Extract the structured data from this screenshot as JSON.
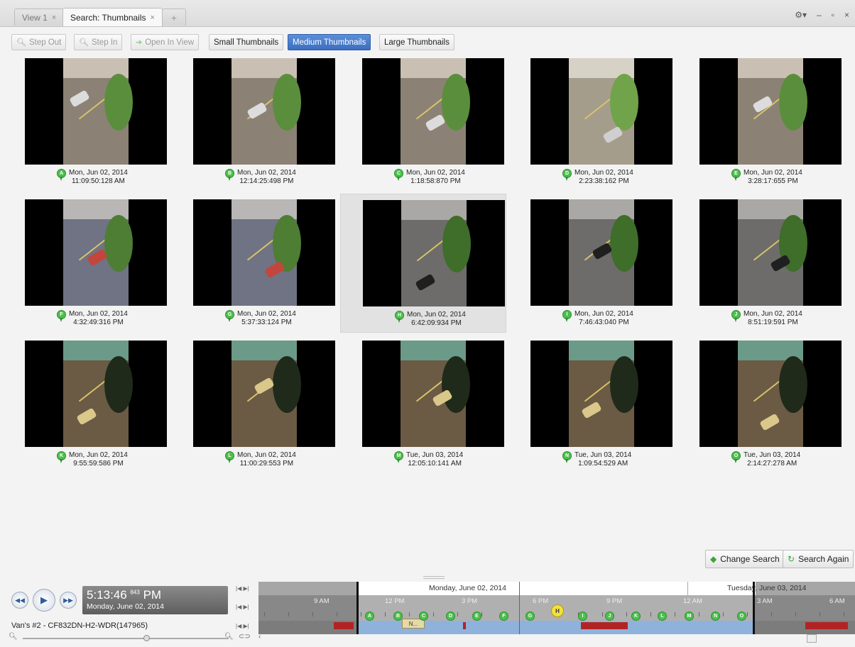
{
  "tabs": [
    {
      "label": "View 1",
      "close": "×"
    },
    {
      "label": "Search: Thumbnails",
      "close": "×"
    },
    {
      "label": "+"
    }
  ],
  "window_controls": {
    "settings": "⚙▾",
    "minimize": "–",
    "maximize": "▫",
    "close": "×"
  },
  "toolbar": {
    "step_out": "Step Out",
    "step_in": "Step In",
    "open_in_view": "Open In View",
    "small": "Small Thumbnails",
    "medium": "Medium Thumbnails",
    "large": "Large Thumbnails",
    "selected": "Medium Thumbnails"
  },
  "thumbnails": [
    {
      "pin": "A",
      "date": "Mon, Jun 02, 2014",
      "time": "11:09:50:128 AM",
      "tone": "day"
    },
    {
      "pin": "B",
      "date": "Mon, Jun 02, 2014",
      "time": "12:14:25:498 PM",
      "tone": "day"
    },
    {
      "pin": "C",
      "date": "Mon, Jun 02, 2014",
      "time": "1:18:58:870 PM",
      "tone": "day"
    },
    {
      "pin": "D",
      "date": "Mon, Jun 02, 2014",
      "time": "2:23:38:162 PM",
      "tone": "bright"
    },
    {
      "pin": "E",
      "date": "Mon, Jun 02, 2014",
      "time": "3:28:17:655 PM",
      "tone": "day"
    },
    {
      "pin": "F",
      "date": "Mon, Jun 02, 2014",
      "time": "4:32:49:316 PM",
      "tone": "blue"
    },
    {
      "pin": "G",
      "date": "Mon, Jun 02, 2014",
      "time": "5:37:33:124 PM",
      "tone": "blue"
    },
    {
      "pin": "H",
      "date": "Mon, Jun 02, 2014",
      "time": "6:42:09:934 PM",
      "tone": "grey",
      "selected": true
    },
    {
      "pin": "I",
      "date": "Mon, Jun 02, 2014",
      "time": "7:46:43:040 PM",
      "tone": "grey"
    },
    {
      "pin": "J",
      "date": "Mon, Jun 02, 2014",
      "time": "8:51:19:591 PM",
      "tone": "grey"
    },
    {
      "pin": "K",
      "date": "Mon, Jun 02, 2014",
      "time": "9:55:59:586 PM",
      "tone": "night"
    },
    {
      "pin": "L",
      "date": "Mon, Jun 02, 2014",
      "time": "11:00:29:553 PM",
      "tone": "night"
    },
    {
      "pin": "M",
      "date": "Tue, Jun 03, 2014",
      "time": "12:05:10:141 AM",
      "tone": "night"
    },
    {
      "pin": "N",
      "date": "Tue, Jun 03, 2014",
      "time": "1:09:54:529 AM",
      "tone": "night"
    },
    {
      "pin": "O",
      "date": "Tue, Jun 03, 2014",
      "time": "2:14:27:278 AM",
      "tone": "night"
    }
  ],
  "actions": {
    "change_search": "Change Search",
    "search_again": "Search Again"
  },
  "playback": {
    "time": "5:13:46",
    "time_ms": "843",
    "ampm": "PM",
    "date": "Monday, June 02, 2014",
    "camera": "Van's #2 - CF832DN-H2-WDR(147965)"
  },
  "timeline": {
    "day1": "Monday, June 02, 2014",
    "day2": "Tuesday, June 03, 2014",
    "hours": [
      "9 AM",
      "12 PM",
      "3 PM",
      "6 PM",
      "9 PM",
      "12 AM",
      "3 AM",
      "6 AM"
    ],
    "markers": [
      "A",
      "B",
      "C",
      "D",
      "E",
      "F",
      "G",
      "H",
      "I",
      "J",
      "K",
      "L",
      "M",
      "N",
      "O"
    ],
    "highlighted_marker": "H",
    "notes_label": "N..."
  },
  "colors": {
    "accent": "#3b6ec0",
    "pin": "#4cc04c",
    "highlight_pin": "#f3e13a",
    "motion": "#b22424",
    "recorded": "#8fb2dc"
  }
}
